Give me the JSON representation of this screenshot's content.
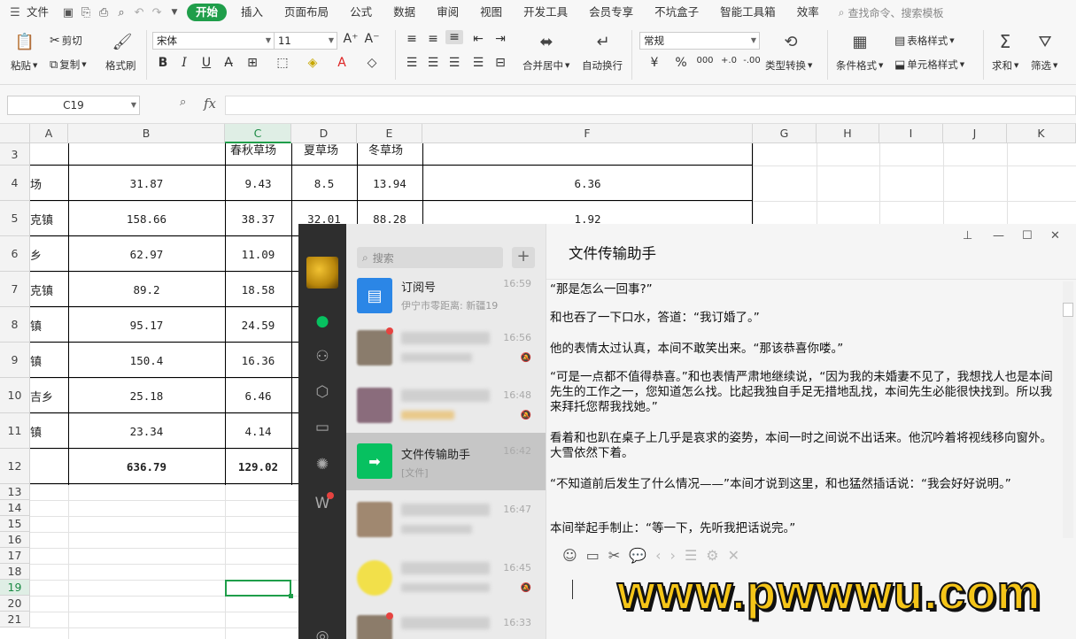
{
  "menu": {
    "file": "文件",
    "tabs": [
      "开始",
      "插入",
      "页面布局",
      "公式",
      "数据",
      "审阅",
      "视图",
      "开发工具",
      "会员专享",
      "不坑盒子",
      "智能工具箱",
      "效率"
    ],
    "active_tab": "开始",
    "search_placeholder": "查找命令、搜索模板"
  },
  "ribbon": {
    "paste": "粘贴",
    "cut": "剪切",
    "copy": "复制",
    "format_painter": "格式刷",
    "font_name": "宋体",
    "font_size": "11",
    "merge_center": "合并居中",
    "wrap_text": "自动换行",
    "number_format": "常规",
    "type_convert": "类型转换",
    "conditional_format": "条件格式",
    "table_style": "表格样式",
    "cell_style": "单元格样式",
    "sum": "求和",
    "filter": "筛选",
    "currency": "¥",
    "percent": "%",
    "thousands": "000",
    "dec_inc": "+.0",
    "dec_dec": "-.00"
  },
  "formula_bar": {
    "name_box": "C19",
    "fx": "fx"
  },
  "sheet": {
    "columns": [
      "A",
      "B",
      "C",
      "D",
      "E",
      "F",
      "G",
      "H",
      "I",
      "J",
      "K"
    ],
    "rows": [
      "3",
      "4",
      "5",
      "6",
      "7",
      "8",
      "9",
      "10",
      "11",
      "12",
      "13",
      "14",
      "15",
      "16",
      "17",
      "18",
      "19",
      "20",
      "21"
    ],
    "header_row": {
      "c": "春秋草场",
      "d": "夏草场",
      "e": "冬草场"
    },
    "data": [
      {
        "a": "场",
        "b": "31.87",
        "c": "9.43",
        "d": "8.5",
        "e": "13.94",
        "f": "6.36"
      },
      {
        "a": "克镇",
        "b": "158.66",
        "c": "38.37",
        "d": "32.01",
        "e": "88.28",
        "f": "1.92"
      },
      {
        "a": "乡",
        "b": "62.97",
        "c": "11.09"
      },
      {
        "a": "克镇",
        "b": "89.2",
        "c": "18.58"
      },
      {
        "a": "镇",
        "b": "95.17",
        "c": "24.59"
      },
      {
        "a": "镇",
        "b": "150.4",
        "c": "16.36"
      },
      {
        "a": "吉乡",
        "b": "25.18",
        "c": "6.46"
      },
      {
        "a": "镇",
        "b": "23.34",
        "c": "4.14"
      },
      {
        "a": "",
        "b": "636.79",
        "c": "129.02"
      }
    ]
  },
  "wechat": {
    "search_placeholder": "搜索",
    "plus": "+",
    "chats": [
      {
        "name": "订阅号",
        "preview": "伊宁市零距离: 新疆19个...",
        "time": "16:59"
      },
      {
        "name": "",
        "preview": "",
        "time": "16:56"
      },
      {
        "name": "",
        "preview": "",
        "time": "16:48"
      },
      {
        "name": "文件传输助手",
        "preview": "[文件]",
        "time": "16:42"
      },
      {
        "name": "",
        "preview": "",
        "time": "16:47"
      },
      {
        "name": "",
        "preview": "",
        "time": "16:45"
      },
      {
        "name": "",
        "preview": "",
        "time": "16:33"
      }
    ],
    "title": "文件传输助手",
    "messages": [
      "“那是怎么一回事?”",
      "和也吞了一下口水，答道：“我订婚了。”",
      "他的表情太过认真，本间不敢笑出来。“那该恭喜你喽。”",
      "“可是一点都不值得恭喜。”和也表情严肃地继续说，“因为我的未婚妻不见了，我想找人也是本间先生的工作之一，您知道怎么找。比起我独自手足无措地乱找，本间先生必能很快找到。所以我来拜托您帮我找她。”",
      "看着和也趴在桌子上几乎是哀求的姿势，本间一时之间说不出话来。他沉吟着将视线移向窗外。大雪依然下着。",
      "“不知道前后发生了什么情况——”本间才说到这里，和也猛然插话说：“我会好好说明。”",
      "本间举起手制止：“等一下，先听我把话说完。”"
    ]
  },
  "watermark": "www.pwwwu.com",
  "colors": {
    "accent": "#1f9e4a",
    "wechat_green": "#07c160"
  }
}
